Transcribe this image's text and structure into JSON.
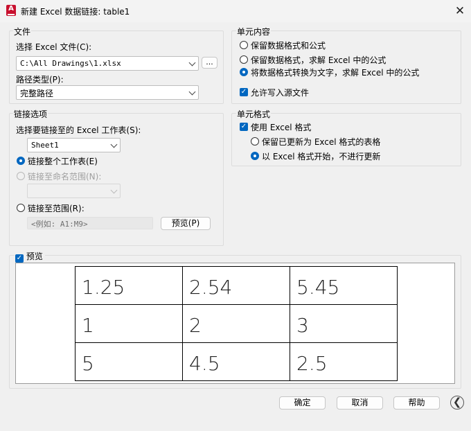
{
  "window": {
    "title": "新建 Excel 数据链接: table1",
    "app_icon_letter": "A",
    "close_glyph": "✕"
  },
  "file_group": {
    "label": "文件",
    "select_label": "选择 Excel 文件(C):",
    "file_value": "C:\\All Drawings\\1.xlsx",
    "browse_label": "...",
    "path_type_label": "路径类型(P):",
    "path_type_value": "完整路径"
  },
  "link_group": {
    "label": "链接选项",
    "sheet_label": "选择要链接至的 Excel 工作表(S):",
    "sheet_value": "Sheet1",
    "whole_sheet_label": "链接整个工作表(E)",
    "named_range_label": "链接至命名范围(N):",
    "range_label": "链接至范围(R):",
    "range_placeholder": "<例如: A1:M9>",
    "preview_button": "预览(P)"
  },
  "cell_content": {
    "label": "单元内容",
    "options": [
      "保留数据格式和公式",
      "保留数据格式，求解 Excel 中的公式",
      "将数据格式转换为文字，求解 Excel 中的公式"
    ],
    "selected_index": 2,
    "allow_write_label": "允许写入源文件"
  },
  "cell_format": {
    "label": "单元格式",
    "use_excel_label": "使用 Excel 格式",
    "options": [
      "保留已更新为 Excel 格式的表格",
      "以 Excel 格式开始，不进行更新"
    ],
    "selected_index": 1
  },
  "preview": {
    "label": "预览",
    "rows": [
      [
        "1.25",
        "2.54",
        "5.45"
      ],
      [
        "1",
        "2",
        "3"
      ],
      [
        "5",
        "4.5",
        "2.5"
      ]
    ]
  },
  "buttons": {
    "ok": "确定",
    "cancel": "取消",
    "help": "帮助",
    "back_glyph": "❮"
  },
  "colors": {
    "accent": "#0067c0",
    "app_icon": "#c8102e"
  }
}
